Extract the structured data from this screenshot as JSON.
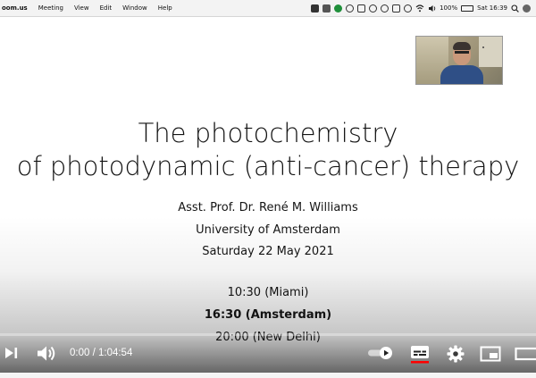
{
  "menubar": {
    "app_name": "oom.us",
    "items": [
      "Meeting",
      "View",
      "Edit",
      "Window",
      "Help"
    ],
    "battery": "100%",
    "clock": "Sat 16:39",
    "tray_icons": [
      "zoom-icon",
      "battery-icon",
      "green-dot-icon",
      "music-icon",
      "bluetooth-icon",
      "info-icon",
      "sync-icon",
      "cast-icon",
      "timer-icon",
      "wifi-icon",
      "volume-icon",
      "search-icon",
      "user-icon"
    ]
  },
  "slide": {
    "title_line1": "The photochemistry",
    "title_line2": "of photodynamic (anti-cancer) therapy",
    "author": "Asst. Prof. Dr. René M. Williams",
    "institution": "University of Amsterdam",
    "date": "Saturday 22 May 2021",
    "times": [
      "10:30 (Miami)",
      "16:30 (Amsterdam)",
      "20:00 (New Delhi)"
    ]
  },
  "player": {
    "current_time": "0:00",
    "duration": "1:04:54",
    "time_separator": " / ",
    "progress": 0,
    "autoplay_on": true,
    "subtitles_on": true,
    "colors": {
      "accent_red": "#ff0000",
      "control_white": "#ffffff"
    }
  }
}
